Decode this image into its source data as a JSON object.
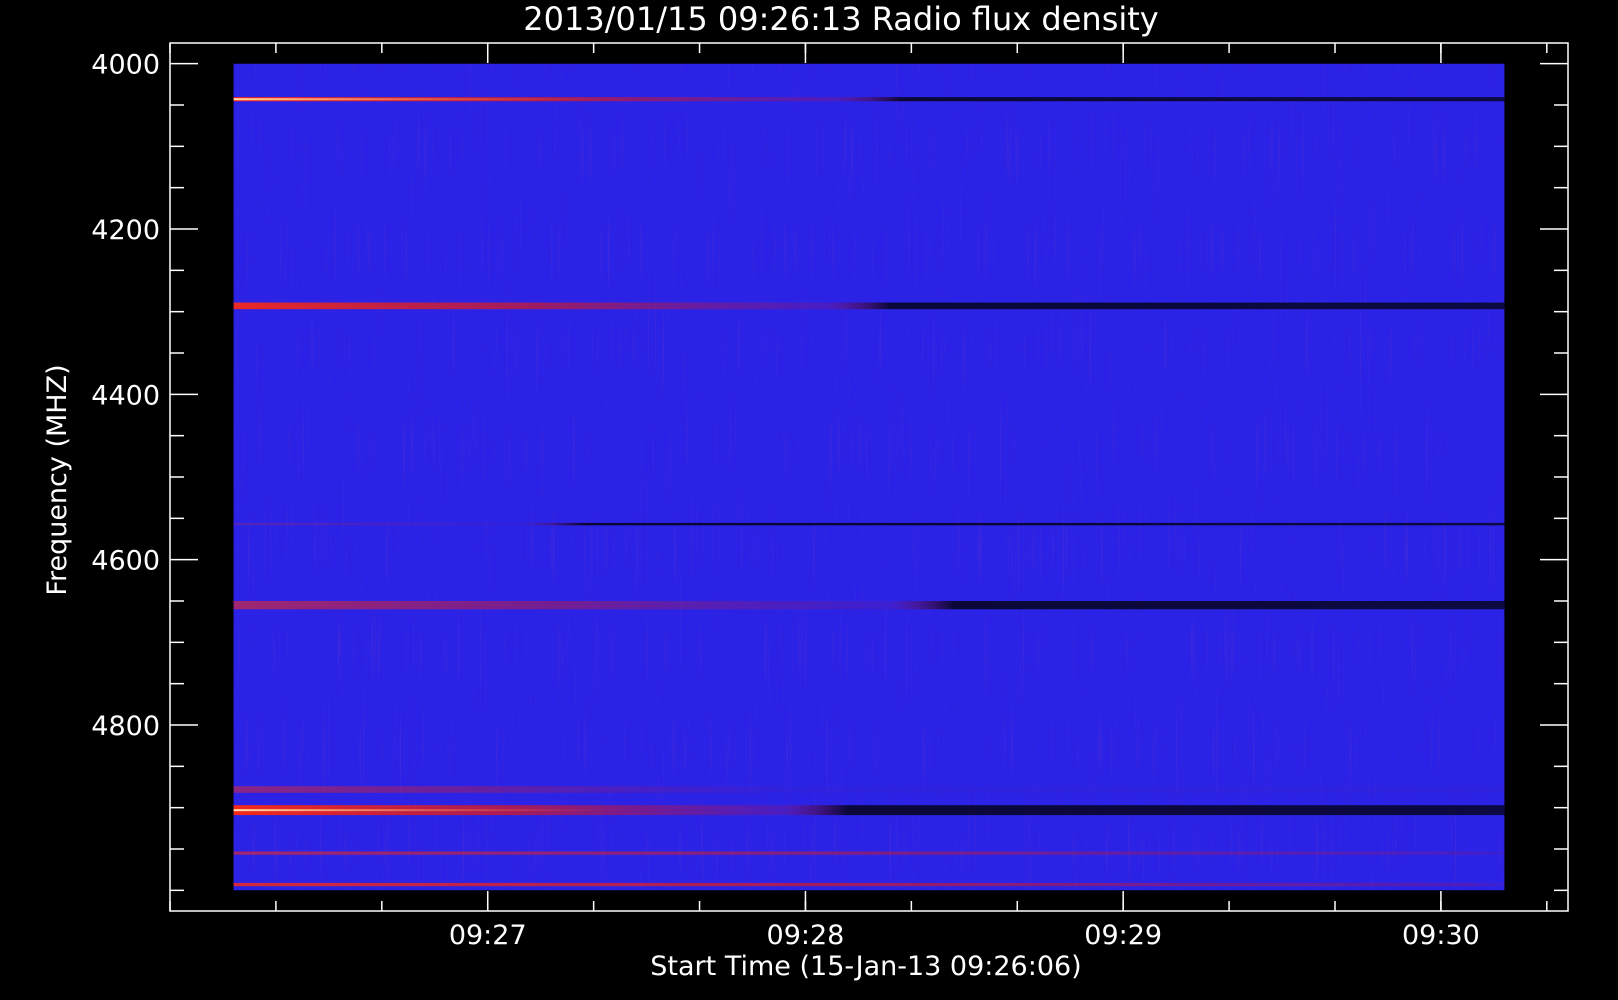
{
  "chart_data": {
    "type": "heatmap",
    "title": "2013/01/15 09:26:13 Radio flux density",
    "xlabel": "Start Time (15-Jan-13 09:26:06)",
    "ylabel": "Frequency (MHZ)",
    "x_major_ticks": [
      {
        "label": "09:27",
        "seconds": 54
      },
      {
        "label": "09:28",
        "seconds": 114
      },
      {
        "label": "09:29",
        "seconds": 174
      },
      {
        "label": "09:30",
        "seconds": 234
      }
    ],
    "x_minor_step_seconds": 20,
    "x_range_seconds": [
      -6,
      258
    ],
    "data_time_range_seconds": [
      6,
      246
    ],
    "y_ticks": [
      4000,
      4200,
      4400,
      4600,
      4800
    ],
    "y_minor_step": 50,
    "ylim": [
      3975,
      5025
    ],
    "data_freq_range": [
      4000,
      5000
    ],
    "y_inverted": true,
    "background_color": "#2a22e8",
    "colors": {
      "frame": "#ffffff",
      "text": "#ffffff",
      "page": "#000000"
    },
    "bands": [
      {
        "freq": 4043,
        "width": 5,
        "strength_start": 1.0,
        "strength_end": 0.5,
        "fade_end_seconds": 120,
        "dark_after": true
      },
      {
        "freq": 4293,
        "width": 8,
        "strength_start": 0.9,
        "strength_end": 0.4,
        "fade_end_seconds": 118,
        "dark_after": true
      },
      {
        "freq": 4557,
        "width": 3,
        "strength_start": 0.2,
        "strength_end": 0.1,
        "fade_end_seconds": 60,
        "dark_after": true
      },
      {
        "freq": 4655,
        "width": 10,
        "strength_start": 0.55,
        "strength_end": 0.25,
        "fade_end_seconds": 130,
        "dark_after": true
      },
      {
        "freq": 4878,
        "width": 8,
        "strength_start": 0.45,
        "strength_end": 0.2,
        "fade_end_seconds": 100,
        "dark_after": false
      },
      {
        "freq": 4903,
        "width": 12,
        "strength_start": 0.95,
        "strength_end": 0.45,
        "fade_end_seconds": 110,
        "dark_after": true
      },
      {
        "freq": 4955,
        "width": 4,
        "strength_start": 0.55,
        "strength_end": 0.4,
        "fade_end_seconds": 240,
        "dark_after": false
      },
      {
        "freq": 4993,
        "width": 4,
        "strength_start": 0.8,
        "strength_end": 0.5,
        "fade_end_seconds": 240,
        "dark_after": false
      }
    ]
  }
}
